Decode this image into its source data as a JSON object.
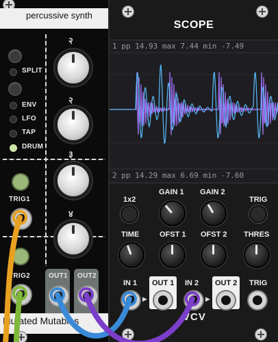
{
  "left_module": {
    "title": "percussive synth",
    "footer": "Mutated Mutables",
    "mode_labels": [
      "SPLIT",
      "ENV",
      "LFO",
      "TAP",
      "DRUM"
    ],
    "active_mode": "DRUM",
    "knob_glyphs": [
      "२",
      "२",
      "३",
      "४"
    ],
    "trig1_label": "TRIG1",
    "trig2_label": "TRIG2",
    "out1_label": "OUT1",
    "out2_label": "OUT2"
  },
  "scope": {
    "title": "SCOPE",
    "ch1": {
      "index": "1",
      "pp_label": "pp",
      "pp": "14.93",
      "max_label": "max",
      "max": "7.44",
      "min_label": "min",
      "min": "-7.49"
    },
    "ch2": {
      "index": "2",
      "pp_label": "pp",
      "pp": "14.29",
      "max_label": "max",
      "max": "6.69",
      "min_label": "min",
      "min": "-7.60"
    },
    "btn_1x2": "1x2",
    "gain1": "GAIN 1",
    "gain2": "GAIN 2",
    "trig_btn": "TRIG",
    "time": "TIME",
    "ofst1": "OFST 1",
    "ofst2": "OFST 2",
    "thres": "THRES",
    "in1": "IN 1",
    "out1": "OUT 1",
    "in2": "IN 2",
    "out2": "OUT 2",
    "trig_jack": "TRIG",
    "brand": "VCV"
  },
  "colors": {
    "trace1": "#55b4f0",
    "trace2": "#a070f0",
    "cable_orange": "#e8a020",
    "cable_green": "#7fb83a",
    "cable_blue": "#3a8ad8",
    "cable_purple": "#7a3ec8"
  }
}
